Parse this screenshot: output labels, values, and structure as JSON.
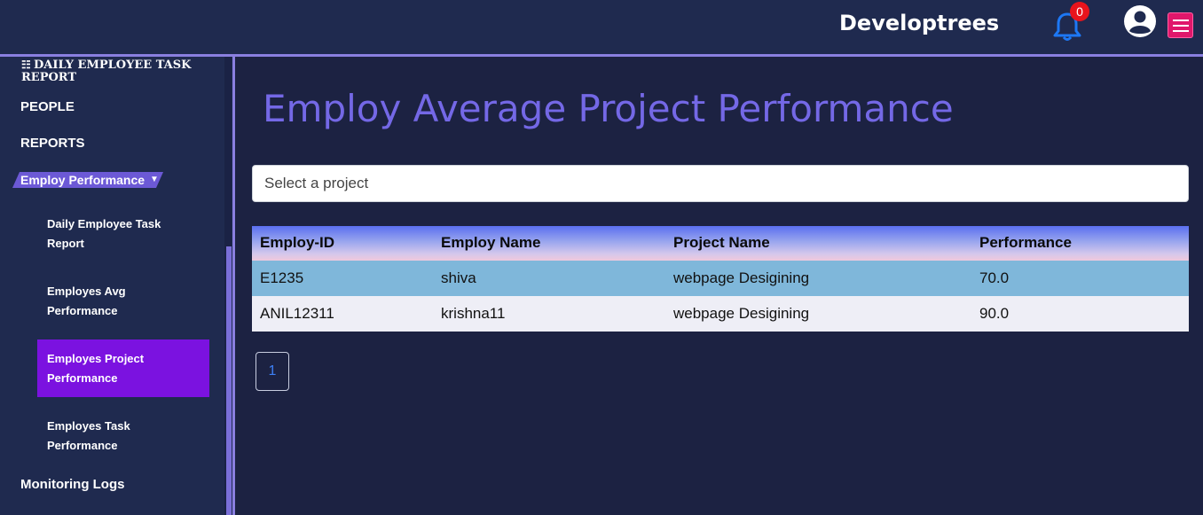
{
  "header": {
    "brand": "Developtrees",
    "notification_count": "0"
  },
  "sidebar": {
    "title": "DAILY EMPLOYEE TASK REPORT",
    "items": [
      {
        "label": "PEOPLE"
      },
      {
        "label": "REPORTS"
      },
      {
        "label": "Employ Performance"
      },
      {
        "label": "Monitoring Logs"
      }
    ],
    "subitems": [
      {
        "label": "Daily Employee Task Report"
      },
      {
        "label": "Employes Avg Performance"
      },
      {
        "label": "Employes Project Performance",
        "active": true
      },
      {
        "label": "Employes Task Performance"
      }
    ]
  },
  "main": {
    "title": "Employ Average Project Performance",
    "select_placeholder": "Select a project",
    "table": {
      "headers": [
        "Employ-ID",
        "Employ Name",
        "Project Name",
        "Performance"
      ],
      "rows": [
        [
          "E1235",
          "shiva",
          "webpage Desigining",
          "70.0"
        ],
        [
          "ANIL12311",
          "krishna11",
          "webpage Desigining",
          "90.0"
        ]
      ]
    },
    "pagination": {
      "current_page": "1"
    }
  },
  "colors": {
    "background": "#1c2242",
    "title_accent": "#7468e6",
    "active_item": "#7b12e0",
    "badge": "#e8141c",
    "menu_button": "#e0176b"
  }
}
